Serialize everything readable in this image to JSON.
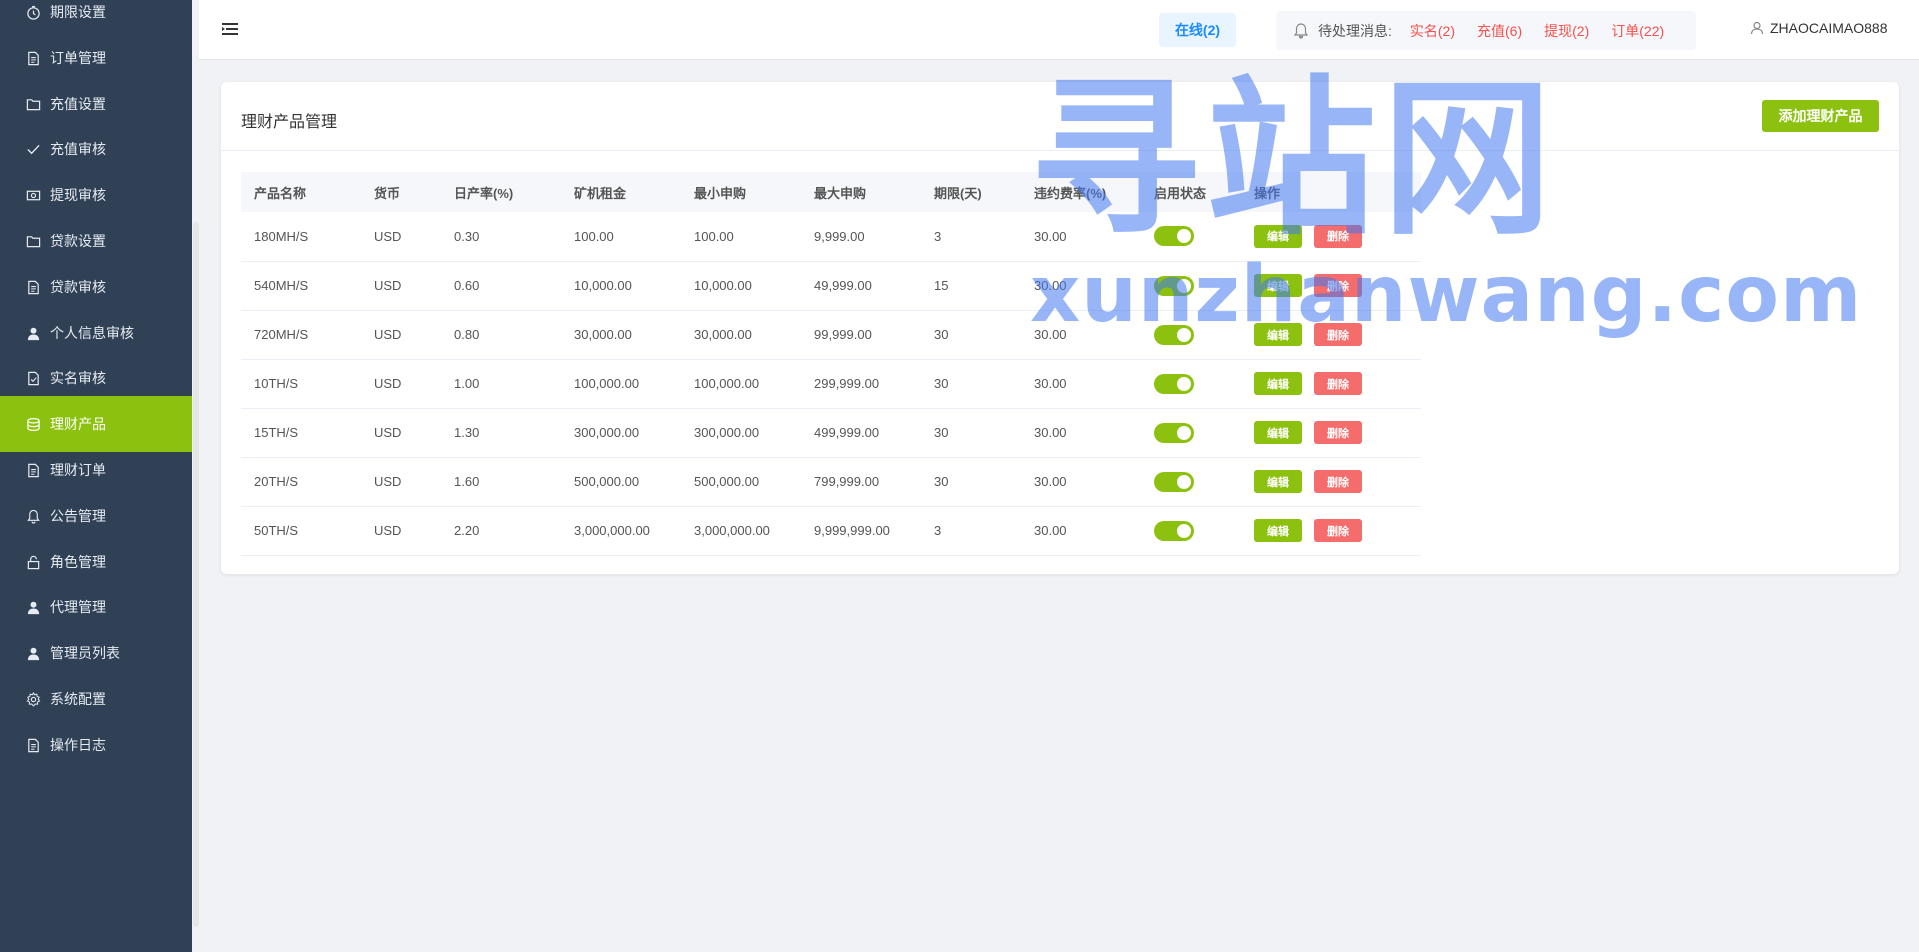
{
  "sidebar": {
    "items": [
      {
        "label": "期限设置",
        "icon": "clock-icon"
      },
      {
        "label": "订单管理",
        "icon": "document-icon"
      },
      {
        "label": "充值设置",
        "icon": "folder-icon"
      },
      {
        "label": "充值审核",
        "icon": "check-icon"
      },
      {
        "label": "提现审核",
        "icon": "money-icon"
      },
      {
        "label": "贷款设置",
        "icon": "folder-icon"
      },
      {
        "label": "贷款审核",
        "icon": "document-icon"
      },
      {
        "label": "个人信息审核",
        "icon": "user-icon"
      },
      {
        "label": "实名审核",
        "icon": "document-check-icon"
      },
      {
        "label": "理财产品",
        "icon": "coins-icon"
      },
      {
        "label": "理财订单",
        "icon": "document-icon"
      },
      {
        "label": "公告管理",
        "icon": "bell-icon"
      },
      {
        "label": "角色管理",
        "icon": "lock-icon"
      },
      {
        "label": "代理管理",
        "icon": "user-icon"
      },
      {
        "label": "管理员列表",
        "icon": "user-icon"
      },
      {
        "label": "系统配置",
        "icon": "gear-icon"
      },
      {
        "label": "操作日志",
        "icon": "document-icon"
      }
    ],
    "active_index": 9
  },
  "header": {
    "online": "在线(2)",
    "pending_label": "待处理消息:",
    "pending_links": [
      "实名(2)",
      "充值(6)",
      "提现(2)",
      "订单(22)"
    ],
    "username": "ZHAOCAIMAO888"
  },
  "card": {
    "title": "理财产品管理",
    "add_button": "添加理财产品"
  },
  "table": {
    "headers": [
      "产品名称",
      "货币",
      "日产率(%)",
      "矿机租金",
      "最小申购",
      "最大申购",
      "期限(天)",
      "违约费率(%)",
      "启用状态",
      "操作"
    ],
    "rows": [
      [
        "180MH/S",
        "USD",
        "0.30",
        "100.00",
        "100.00",
        "9,999.00",
        "3",
        "30.00"
      ],
      [
        "540MH/S",
        "USD",
        "0.60",
        "10,000.00",
        "10,000.00",
        "49,999.00",
        "15",
        "30.00"
      ],
      [
        "720MH/S",
        "USD",
        "0.80",
        "30,000.00",
        "30,000.00",
        "99,999.00",
        "30",
        "30.00"
      ],
      [
        "10TH/S",
        "USD",
        "1.00",
        "100,000.00",
        "100,000.00",
        "299,999.00",
        "30",
        "30.00"
      ],
      [
        "15TH/S",
        "USD",
        "1.30",
        "300,000.00",
        "300,000.00",
        "499,999.00",
        "30",
        "30.00"
      ],
      [
        "20TH/S",
        "USD",
        "1.60",
        "500,000.00",
        "500,000.00",
        "799,999.00",
        "30",
        "30.00"
      ],
      [
        "50TH/S",
        "USD",
        "2.20",
        "3,000,000.00",
        "3,000,000.00",
        "9,999,999.00",
        "3",
        "30.00"
      ]
    ],
    "enabled": [
      true,
      true,
      true,
      true,
      true,
      true,
      true
    ],
    "edit_label": "编辑",
    "delete_label": "删除"
  },
  "watermark": {
    "big": "寻站网",
    "small": "xunzhanwang.com"
  },
  "colors": {
    "sidebar_bg": "#304156",
    "accent": "#8cc20f",
    "danger": "#f56c6c",
    "link_red": "#f5504c",
    "online_blue": "#1a8cff"
  }
}
